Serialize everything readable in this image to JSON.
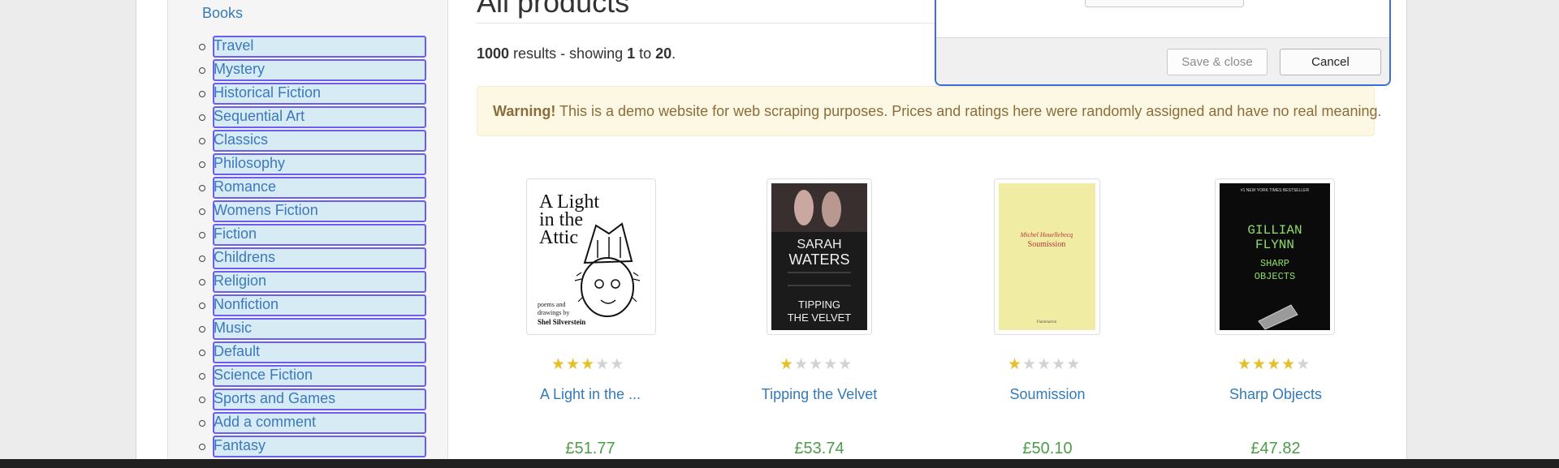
{
  "breadcrumb": {
    "books_label": "Books"
  },
  "categories": [
    "Travel",
    "Mystery",
    "Historical Fiction",
    "Sequential Art",
    "Classics",
    "Philosophy",
    "Romance",
    "Womens Fiction",
    "Fiction",
    "Childrens",
    "Religion",
    "Nonfiction",
    "Music",
    "Default",
    "Science Fiction",
    "Sports and Games",
    "Add a comment",
    "Fantasy"
  ],
  "main": {
    "title": "All products",
    "results": {
      "total": "1000",
      "text1": " results - showing ",
      "from": "1",
      "text2": " to ",
      "to": "20",
      "text3": "."
    },
    "warning": {
      "strong": "Warning!",
      "text": " This is a demo website for web scraping purposes. Prices and ratings here were randomly assigned and have no real meaning."
    }
  },
  "products": [
    {
      "title": "A Light in the ...",
      "price": "£51.77",
      "rating": 3,
      "cover": {
        "line1": "A Light",
        "line2": "in the",
        "line3": "Attic",
        "sub1": "poems and",
        "sub2": "drawings by",
        "author": "Shel Silverstein"
      }
    },
    {
      "title": "Tipping the Velvet",
      "price": "£53.74",
      "rating": 1,
      "cover": {
        "line1": "SARAH",
        "line2": "WATERS",
        "line3": "TIPPING",
        "line4": "THE VELVET"
      }
    },
    {
      "title": "Soumission",
      "price": "£50.10",
      "rating": 1,
      "cover": {
        "author": "Michel Houellebecq",
        "title": "Soumission",
        "publisher": "Flammarion"
      }
    },
    {
      "title": "Sharp Objects",
      "price": "£47.82",
      "rating": 4,
      "cover": {
        "top": "#1 NEW YORK TIMES BESTSELLER",
        "line1": "GILLIAN",
        "line2": "FLYNN",
        "line3": "SHARP",
        "line4": "OBJECTS"
      }
    }
  ],
  "dialog": {
    "save_label": "Save & close",
    "cancel_label": "Cancel"
  },
  "colors": {
    "star_on": "#e5c02b",
    "star_off": "#d2d2d2",
    "price": "#4c9c48",
    "link": "#337ab7",
    "highlight_border": "#6a5ef0"
  }
}
